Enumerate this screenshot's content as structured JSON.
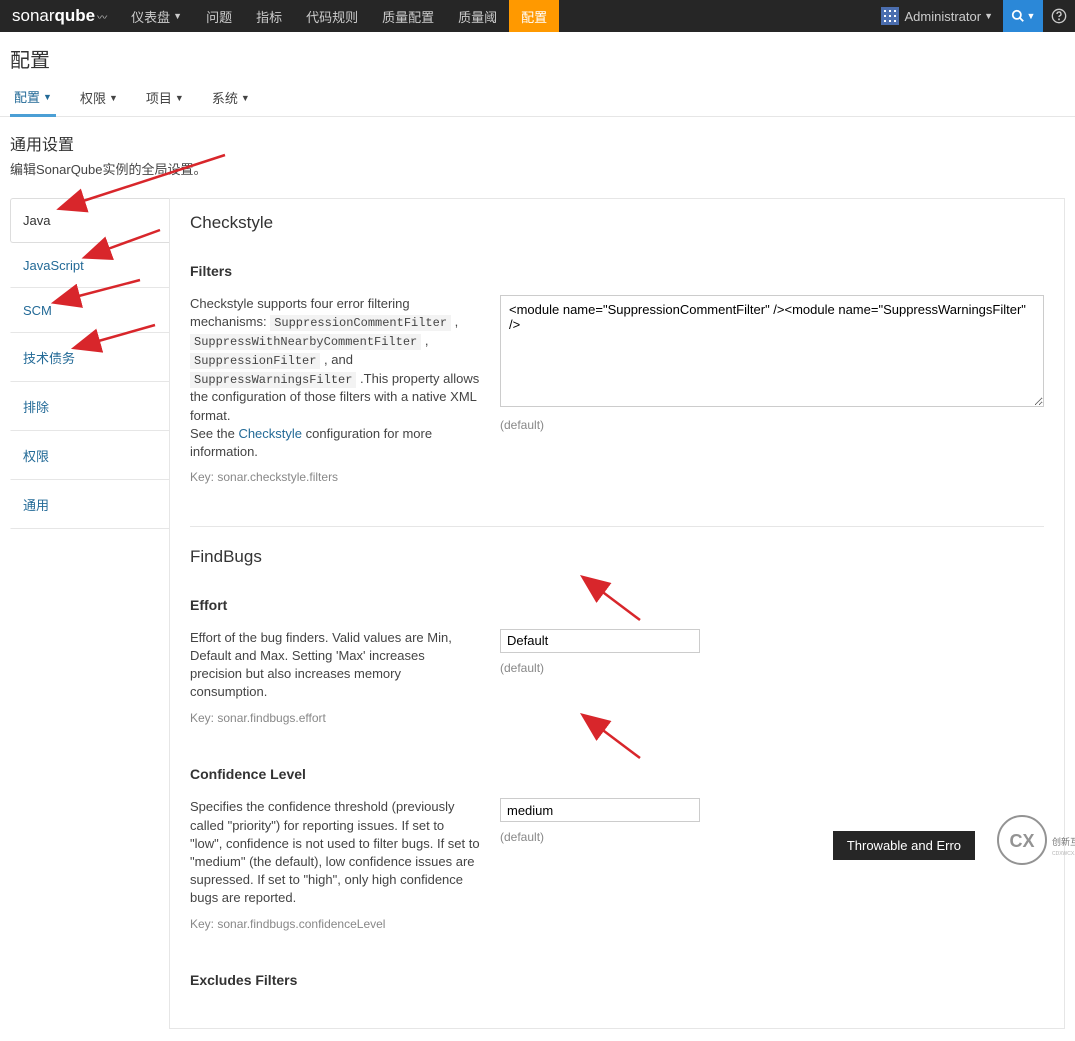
{
  "brand": {
    "part1": "sonar",
    "part2": "qube"
  },
  "nav": {
    "items": [
      {
        "label": "仪表盘",
        "caret": true
      },
      {
        "label": "问题"
      },
      {
        "label": "指标"
      },
      {
        "label": "代码规则"
      },
      {
        "label": "质量配置"
      },
      {
        "label": "质量阈"
      },
      {
        "label": "配置",
        "active": true
      }
    ],
    "admin": "Administrator"
  },
  "page": {
    "title": "配置",
    "subnav": [
      {
        "label": "配置",
        "caret": true,
        "active": true
      },
      {
        "label": "权限",
        "caret": true
      },
      {
        "label": "项目",
        "caret": true
      },
      {
        "label": "系统",
        "caret": true
      }
    ],
    "section_title": "通用设置",
    "section_desc": "编辑SonarQube实例的全局设置。"
  },
  "sidetabs": [
    {
      "label": "Java",
      "active": true
    },
    {
      "label": "JavaScript"
    },
    {
      "label": "SCM"
    },
    {
      "label": "技术债务"
    },
    {
      "label": "排除"
    },
    {
      "label": "权限"
    },
    {
      "label": "通用"
    }
  ],
  "checkstyle": {
    "title": "Checkstyle",
    "filters_title": "Filters",
    "filters_desc1": "Checkstyle supports four error filtering mechanisms: ",
    "c1": "SuppressionCommentFilter",
    "sep1": " , ",
    "c2": "SuppressWithNearbyCommentFilter",
    "sep2": " , ",
    "c3": "SuppressionFilter",
    "sep3": " , and ",
    "c4": "SuppressWarningsFilter",
    "desc2": " .This property allows the configuration of those filters with a native XML format.",
    "see": "See the ",
    "link": "Checkstyle",
    "see2": " configuration for more information.",
    "key": "Key: sonar.checkstyle.filters",
    "value": "<module name=\"SuppressionCommentFilter\" /><module name=\"SuppressWarningsFilter\" />",
    "default": "(default)"
  },
  "findbugs": {
    "title": "FindBugs",
    "effort_title": "Effort",
    "effort_desc": "Effort of the bug finders. Valid values are Min, Default and Max. Setting 'Max' increases precision but also increases memory consumption.",
    "effort_key": "Key: sonar.findbugs.effort",
    "effort_value": "Default",
    "conf_title": "Confidence Level",
    "conf_desc": "Specifies the confidence threshold (previously called \"priority\") for reporting issues. If set to \"low\", confidence is not used to filter bugs. If set to \"medium\" (the default), low confidence issues are supressed. If set to \"high\", only high confidence bugs are reported.",
    "conf_key": "Key: sonar.findbugs.confidenceLevel",
    "conf_value": "medium",
    "excludes_title": "Excludes Filters",
    "default": "(default)"
  },
  "footer_notice": "Throwable and Erro",
  "watermark": "创新互联"
}
